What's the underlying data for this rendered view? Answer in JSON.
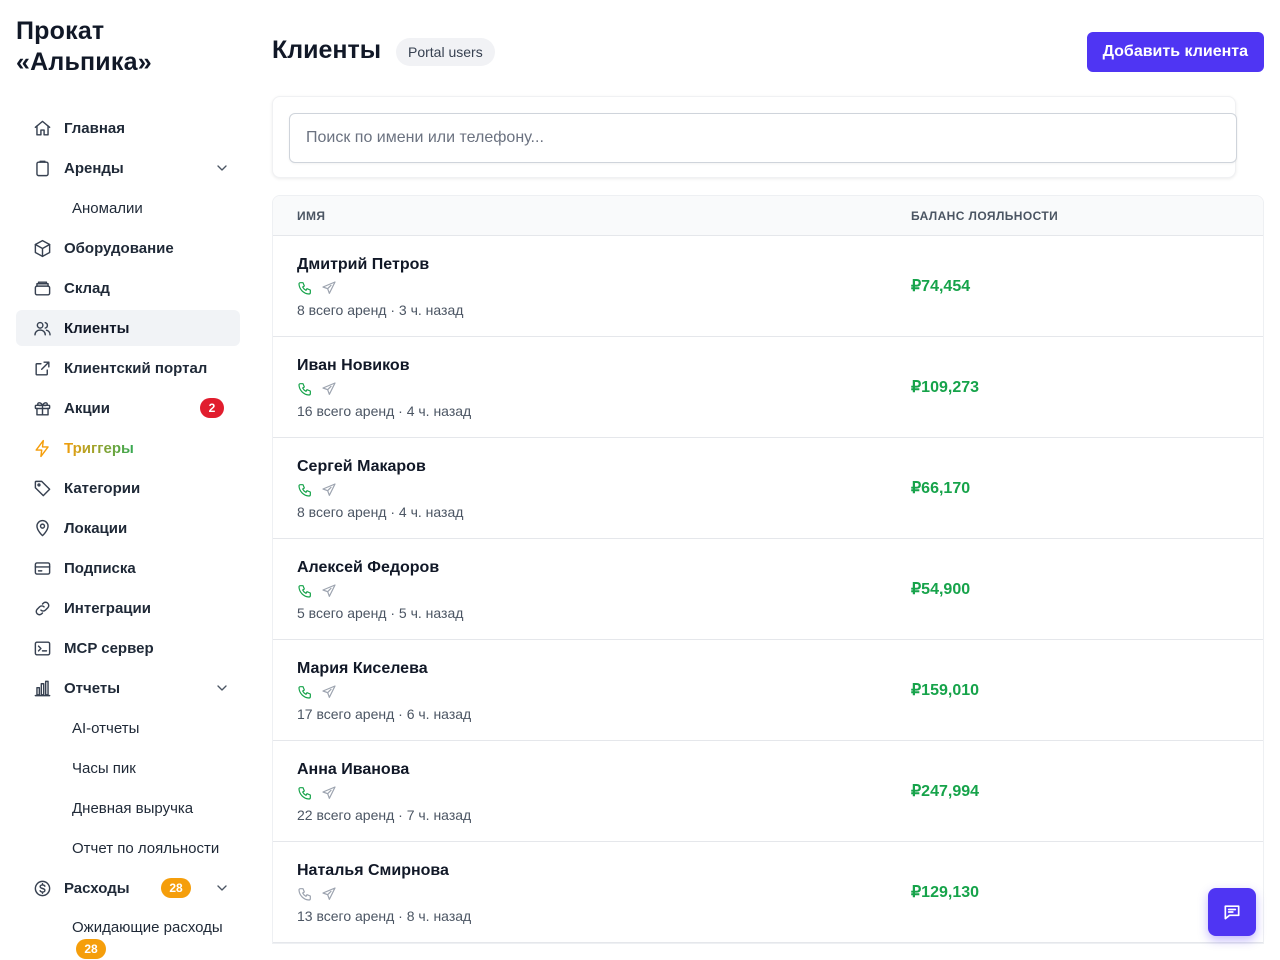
{
  "brand": {
    "line1": "Прокат",
    "line2": "«Альпика»"
  },
  "sidebar": {
    "items": [
      {
        "label": "Главная",
        "icon": "home-icon"
      },
      {
        "label": "Аренды",
        "icon": "clipboard-icon"
      },
      {
        "label": "Аномалии"
      },
      {
        "label": "Оборудование",
        "icon": "cube-icon"
      },
      {
        "label": "Склад",
        "icon": "archive-icon"
      },
      {
        "label": "Клиенты",
        "icon": "users-icon"
      },
      {
        "label": "Клиентский портал",
        "icon": "external-link-icon"
      },
      {
        "label": "Акции",
        "icon": "gift-icon",
        "badge": "2"
      },
      {
        "label": "Триггеры",
        "icon": "bolt-icon"
      },
      {
        "label": "Категории",
        "icon": "tag-icon"
      },
      {
        "label": "Локации",
        "icon": "location-pin-icon"
      },
      {
        "label": "Подписка",
        "icon": "credit-card-icon"
      },
      {
        "label": "Интеграции",
        "icon": "link-icon"
      },
      {
        "label": "MCP сервер",
        "icon": "terminal-icon"
      },
      {
        "label": "Отчеты",
        "icon": "bar-chart-icon"
      },
      {
        "label": "AI-отчеты"
      },
      {
        "label": "Часы пик"
      },
      {
        "label": "Дневная выручка"
      },
      {
        "label": "Отчет по лояльности"
      },
      {
        "label": "Расходы",
        "icon": "dollar-circle-icon",
        "badge": "28"
      },
      {
        "label": "Ожидающие расходы",
        "badge": "28"
      }
    ]
  },
  "header": {
    "title": "Клиенты",
    "pill": "Portal users",
    "add_button": "Добавить клиента"
  },
  "search": {
    "placeholder": "Поиск по имени или телефону..."
  },
  "table": {
    "columns": [
      "ИМЯ",
      "БАЛАНС ЛОЯЛЬНОСТИ"
    ],
    "rows": [
      {
        "name": "Дмитрий Петров",
        "meta": "8 всего аренд · 3 ч. назад",
        "balance": "₽74,454",
        "phone_active": true
      },
      {
        "name": "Иван Новиков",
        "meta": "16 всего аренд · 4 ч. назад",
        "balance": "₽109,273",
        "phone_active": true
      },
      {
        "name": "Сергей Макаров",
        "meta": "8 всего аренд · 4 ч. назад",
        "balance": "₽66,170",
        "phone_active": true
      },
      {
        "name": "Алексей Федоров",
        "meta": "5 всего аренд · 5 ч. назад",
        "balance": "₽54,900",
        "phone_active": true
      },
      {
        "name": "Мария Киселева",
        "meta": "17 всего аренд · 6 ч. назад",
        "balance": "₽159,010",
        "phone_active": true
      },
      {
        "name": "Анна Иванова",
        "meta": "22 всего аренд · 7 ч. назад",
        "balance": "₽247,994",
        "phone_active": true
      },
      {
        "name": "Наталья Смирнова",
        "meta": "13 всего аренд · 8 ч. назад",
        "balance": "₽129,130",
        "phone_active": false
      }
    ]
  },
  "colors": {
    "accent": "#4f35f3",
    "balance": "#16a34a",
    "badge_red": "#e11d2e",
    "badge_orange": "#f59e0b"
  }
}
